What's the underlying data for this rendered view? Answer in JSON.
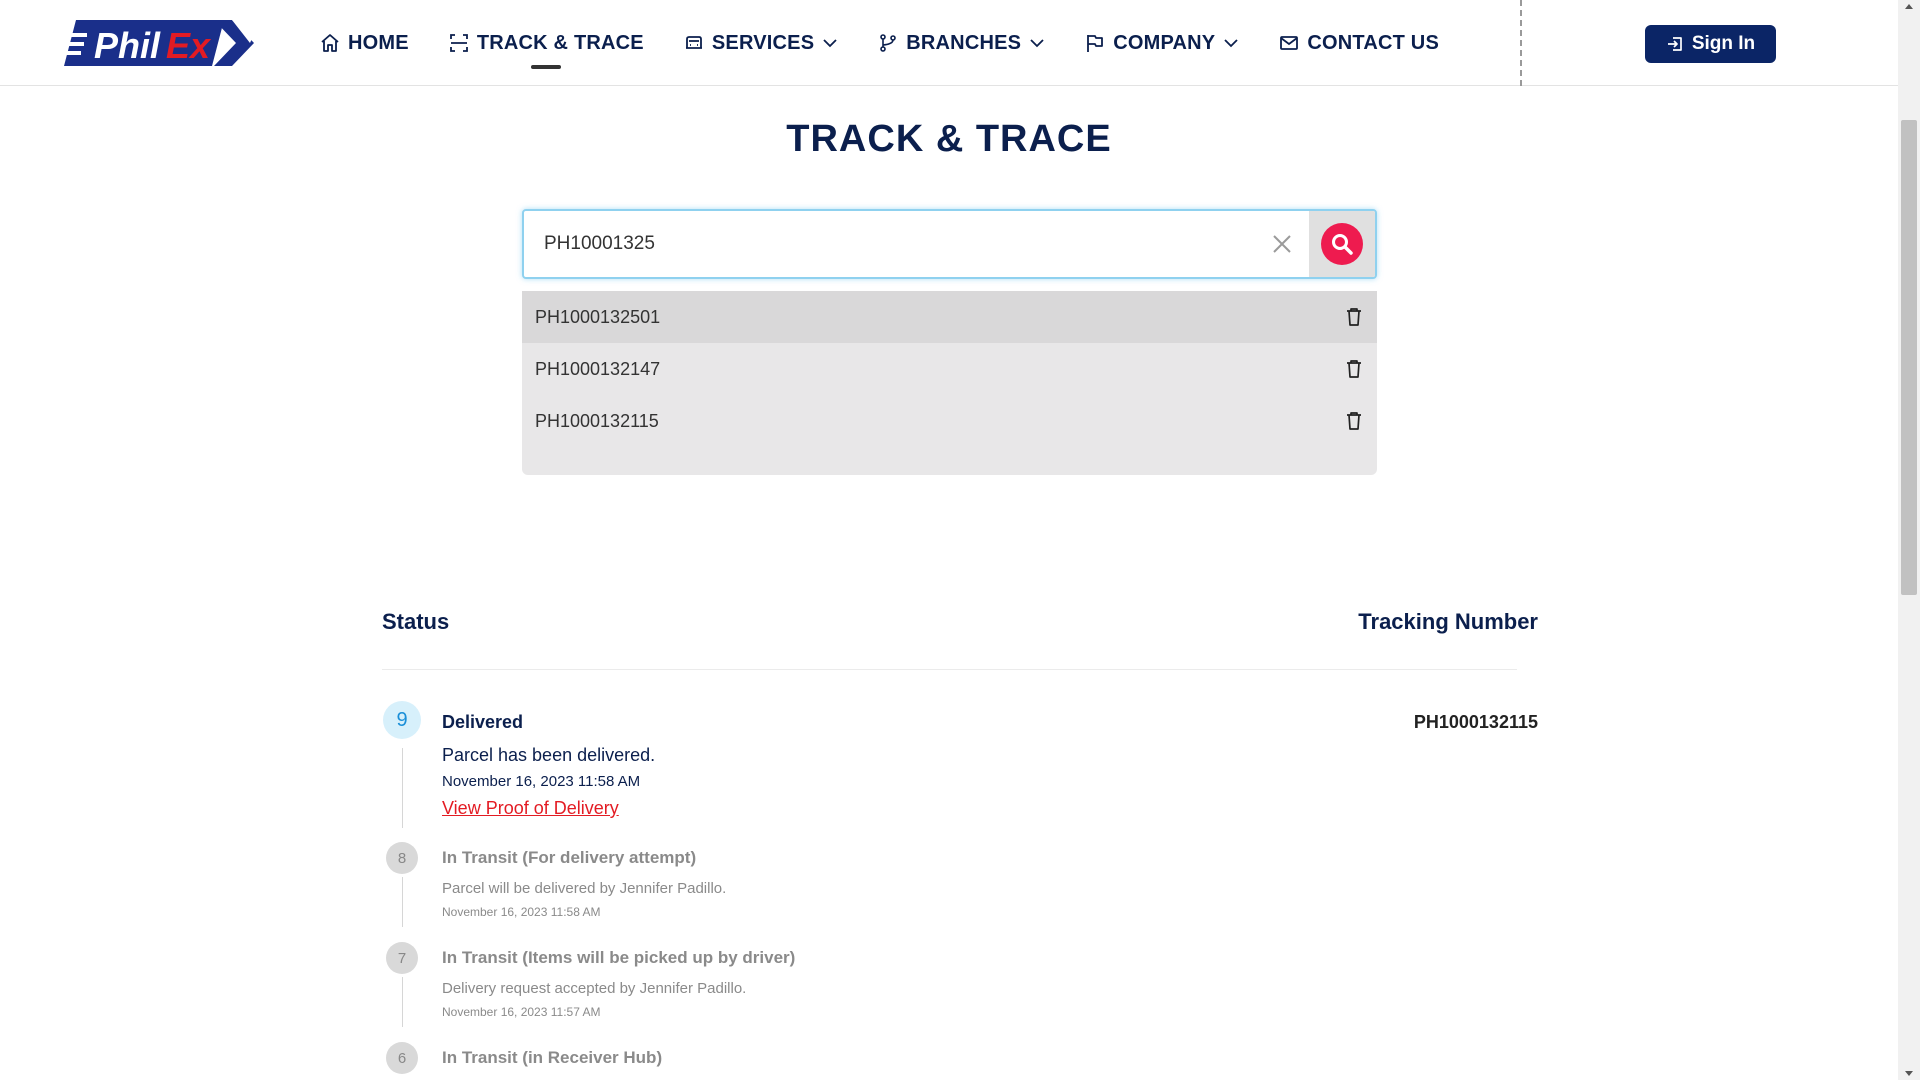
{
  "header": {
    "logo_text": "PhilEx",
    "nav": [
      {
        "label": "HOME",
        "icon": "home-icon",
        "has_dropdown": false,
        "active": false
      },
      {
        "label": "TRACK & TRACE",
        "icon": "scan-icon",
        "has_dropdown": false,
        "active": true
      },
      {
        "label": "SERVICES",
        "icon": "truck-icon",
        "has_dropdown": true,
        "active": false
      },
      {
        "label": "BRANCHES",
        "icon": "branch-icon",
        "has_dropdown": true,
        "active": false
      },
      {
        "label": "COMPANY",
        "icon": "flag-icon",
        "has_dropdown": true,
        "active": false
      },
      {
        "label": "CONTACT US",
        "icon": "mail-icon",
        "has_dropdown": false,
        "active": false
      }
    ],
    "sign_in_label": "Sign In"
  },
  "page": {
    "title": "TRACK & TRACE"
  },
  "search": {
    "value": "PH10001325",
    "history": [
      "PH1000132501",
      "PH1000132147",
      "PH1000132115"
    ]
  },
  "results": {
    "status_header": "Status",
    "tracking_header": "Tracking Number",
    "tracking_number": "PH1000132115",
    "events": [
      {
        "step": "9",
        "title": "Delivered",
        "description": "Parcel has been delivered.",
        "date": "November 16, 2023 11:58 AM",
        "link": "View Proof of Delivery"
      },
      {
        "step": "8",
        "title": "In Transit (For delivery attempt)",
        "description": "Parcel will be delivered by Jennifer Padillo.",
        "date": "November 16, 2023 11:58 AM"
      },
      {
        "step": "7",
        "title": "In Transit (Items will be picked up by driver)",
        "description": "Delivery request accepted by Jennifer Padillo.",
        "date": "November 16, 2023 11:57 AM"
      },
      {
        "step": "6",
        "title": "In Transit (in Receiver Hub)"
      }
    ]
  },
  "colors": {
    "navy": "#0b1f4d",
    "sign_in_bg": "#0b2566",
    "search_accent": "#ee1b4f",
    "link_red": "#e31b23",
    "current_badge_bg": "#d7f0fb"
  }
}
